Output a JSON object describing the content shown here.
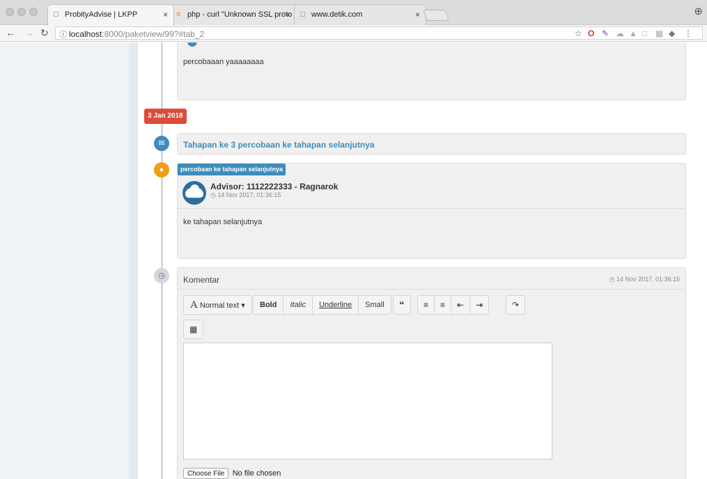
{
  "browser": {
    "tabs": [
      {
        "title": "ProbityAdvise | LKPP",
        "close": "×"
      },
      {
        "title": "php - curl \"Unknown SSL proto",
        "close": "×"
      },
      {
        "title": "www.detik.com",
        "close": "×"
      }
    ],
    "url_host": "localhost",
    "url_rest": ":8000/paketview/99?#tab_2"
  },
  "timeline": {
    "item1_body": "percobaaan yaaaaaaaa",
    "date_label": "3 Jan 2018",
    "item2_title": "Tahapan ke 3 percobaan ke tahapan selanjutnya",
    "item3": {
      "tag": "percobaan ke tahapan selanjutnya",
      "advisor": "Advisor: 1112222333 - Ragnarok",
      "time": "14 Nov 2017, 01:36:15",
      "body": "ke tahapan selanjutnya"
    },
    "item4": {
      "title": "Komentar",
      "time": "14 Nov 2017, 01:36:15",
      "toolbar": {
        "normal_text": "Normal text",
        "bold": "Bold",
        "italic": "Italic",
        "underline": "Underline",
        "small": "Small"
      },
      "file_button": "Choose File",
      "file_status": "No file chosen"
    }
  },
  "colors": {
    "accent": "#3c8dbc",
    "date_label": "#dd4b39",
    "comment_icon": "#f39c12"
  }
}
